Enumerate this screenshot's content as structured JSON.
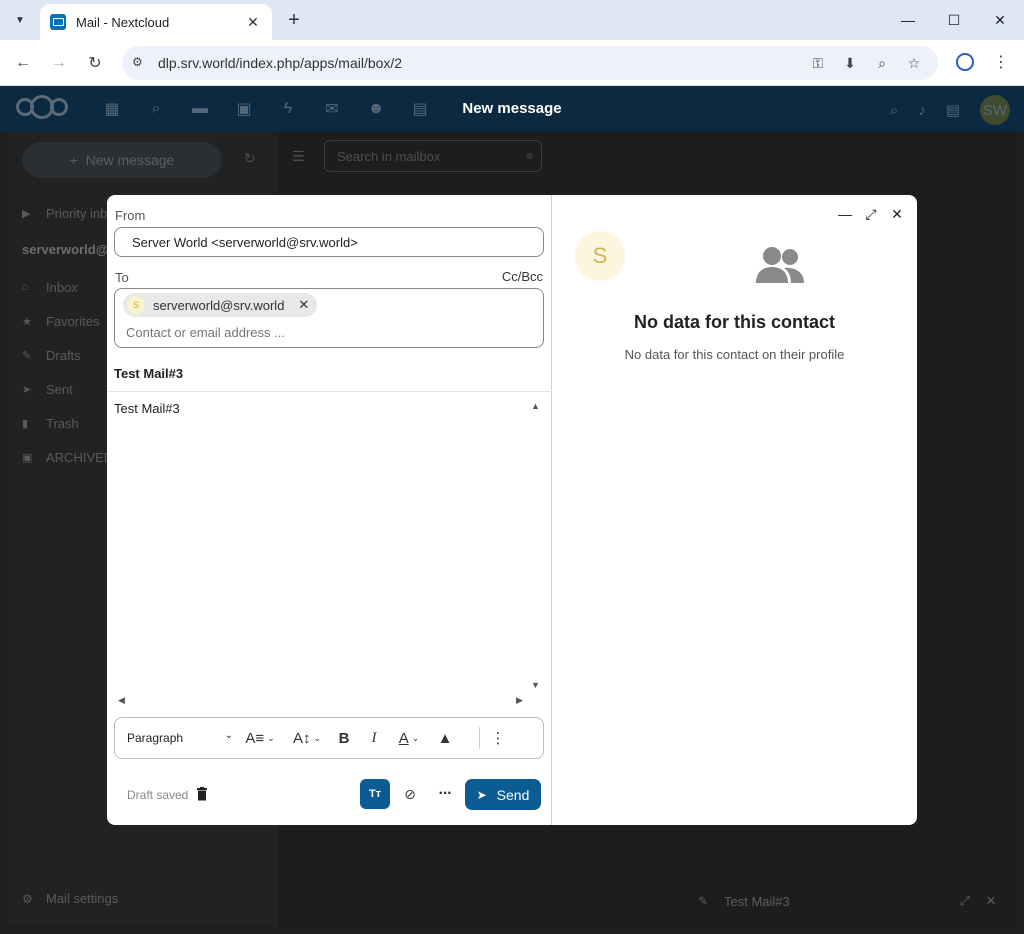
{
  "browser": {
    "tab_title": "Mail - Nextcloud",
    "url": "dlp.srv.world/index.php/apps/mail/box/2"
  },
  "nextcloud": {
    "header_title": "New message",
    "avatar_initials": "SW",
    "sidebar": {
      "new_message": "New message",
      "priority_inbox": "Priority inbox",
      "account": "serverworld@srv.world",
      "items": [
        {
          "label": "Inbox",
          "icon": "inbox-icon"
        },
        {
          "label": "Favorites",
          "icon": "star-icon"
        },
        {
          "label": "Drafts",
          "icon": "pencil-icon"
        },
        {
          "label": "Sent",
          "icon": "send-icon"
        },
        {
          "label": "Trash",
          "icon": "trash-icon"
        },
        {
          "label": "ARCHIVED",
          "icon": "archive-icon"
        }
      ],
      "settings": "Mail settings"
    },
    "search_placeholder": "Search in mailbox",
    "minimized_compose_title": "Test Mail#3"
  },
  "compose": {
    "from_label": "From",
    "from_value": "Server World <serverworld@srv.world>",
    "to_label": "To",
    "ccbcc_label": "Cc/Bcc",
    "recipient": {
      "initial": "S",
      "email": "serverworld@srv.world"
    },
    "to_placeholder": "Contact or email address ...",
    "subject": "Test Mail#3",
    "body": "Test Mail#3",
    "paragraph_style": "Paragraph",
    "draft_status": "Draft saved",
    "tt_label": "Tт",
    "send_label": "Send"
  },
  "contact": {
    "initial": "S",
    "title": "No data for this contact",
    "subtitle": "No data for this contact on their profile"
  },
  "colors": {
    "primary": "#0b5c93",
    "header": "#0b2940",
    "avatar_bg": "#fbf6dd",
    "avatar_fg": "#d5b14a"
  }
}
